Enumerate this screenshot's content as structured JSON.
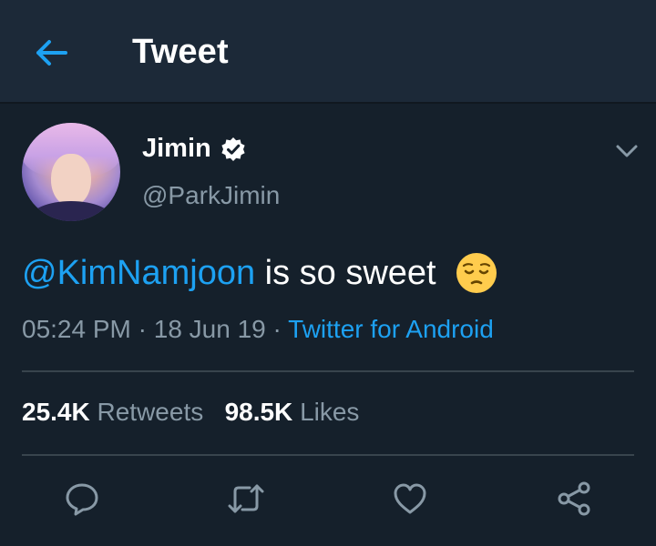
{
  "header": {
    "title": "Tweet",
    "back_icon": "arrow-left-icon"
  },
  "tweet": {
    "author_name": "Jimin",
    "author_handle": "@ParkJimin",
    "verified": true,
    "mention": "@KimNamjoon",
    "text_rest": " is so sweet",
    "emoji": "pensive-face",
    "time": "05:24 PM",
    "sep1": " · ",
    "date": "18 Jun 19",
    "sep2": " · ",
    "source": "Twitter for Android"
  },
  "stats": {
    "retweets_count": "25.4K",
    "retweets_label": "Retweets",
    "likes_count": "98.5K",
    "likes_label": "Likes"
  },
  "actions": [
    "reply-icon",
    "retweet-icon",
    "like-icon",
    "share-icon"
  ],
  "colors": {
    "background": "#15202b",
    "header": "#1c2938",
    "accent": "#1da1f2",
    "secondary_text": "#8899a6",
    "divider": "#38444d"
  }
}
